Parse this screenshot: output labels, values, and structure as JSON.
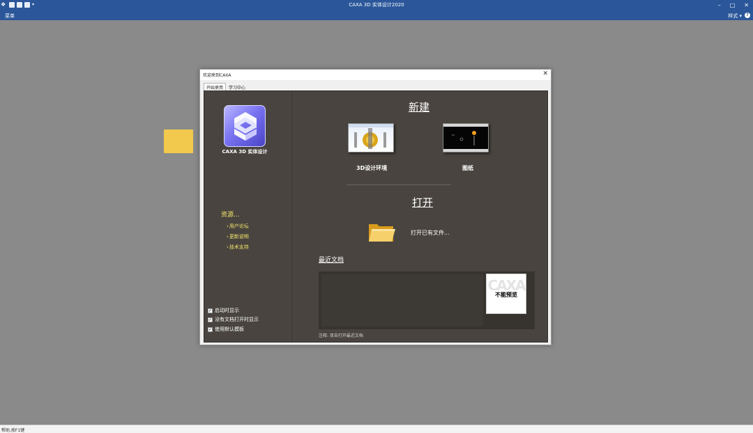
{
  "app": {
    "title": "CAXA 3D 实体设计2020",
    "menu_label": "菜单",
    "style_label": "样式",
    "help_icon": "help-icon"
  },
  "statusbar": {
    "text": "帮助,按F1键"
  },
  "dialog": {
    "title": "欢迎来到CAXA",
    "tabs": [
      {
        "label": "开始使用"
      },
      {
        "label": "学习中心"
      }
    ],
    "product_name": "CAXA 3D 实体设计",
    "resources_title": "资源...",
    "resource_links": [
      {
        "label": "用户论坛"
      },
      {
        "label": "更新说明"
      },
      {
        "label": "技术支持"
      }
    ],
    "checkboxes": [
      {
        "label": "启动时显示",
        "checked": true
      },
      {
        "label": "没有文档打开时显示",
        "checked": true
      },
      {
        "label": "使用默认模板",
        "checked": true
      }
    ],
    "new_section": {
      "heading": "新建",
      "items": [
        {
          "label": "3D设计环境"
        },
        {
          "label": "图纸"
        }
      ]
    },
    "open_section": {
      "heading": "打开",
      "open_existing_label": "打开已有文件..."
    },
    "recent_section": {
      "heading": "最近文档",
      "preview_text": "不能预览",
      "note": "注释: 双击打开最近文档"
    }
  },
  "colors": {
    "titlebar": "#2b579a",
    "workspace": "#8a8a8a",
    "content_bg": "#49443f",
    "link_yellow": "#f3e66a"
  }
}
